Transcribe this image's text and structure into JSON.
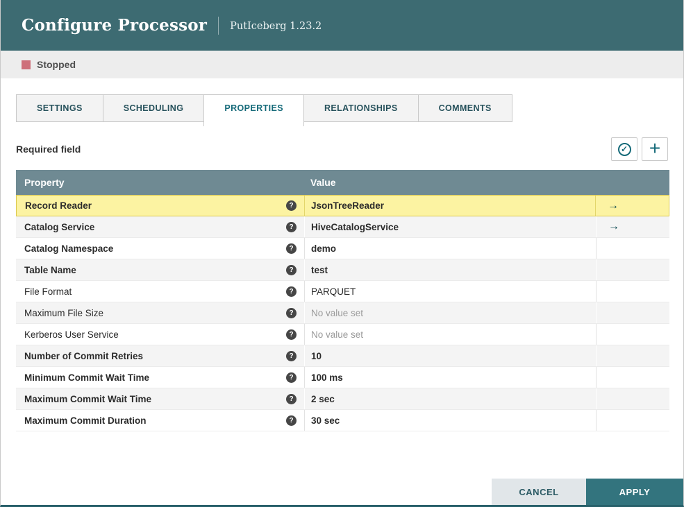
{
  "header": {
    "title": "Configure Processor",
    "subtitle": "PutIceberg 1.23.2"
  },
  "status": {
    "label": "Stopped"
  },
  "tabs": [
    {
      "label": "SETTINGS",
      "active": false
    },
    {
      "label": "SCHEDULING",
      "active": false
    },
    {
      "label": "PROPERTIES",
      "active": true
    },
    {
      "label": "RELATIONSHIPS",
      "active": false
    },
    {
      "label": "COMMENTS",
      "active": false
    }
  ],
  "properties_panel": {
    "required_label": "Required field"
  },
  "icons": {
    "help": "?",
    "goto_arrow": "→",
    "add_property": "+",
    "verify_check": "✓"
  },
  "table": {
    "columns": [
      "Property",
      "Value"
    ],
    "rows": [
      {
        "property": "Record Reader",
        "value": "JsonTreeReader",
        "required": true,
        "empty": false,
        "has_link": true,
        "selected": true
      },
      {
        "property": "Catalog Service",
        "value": "HiveCatalogService",
        "required": true,
        "empty": false,
        "has_link": true,
        "selected": false
      },
      {
        "property": "Catalog Namespace",
        "value": "demo",
        "required": true,
        "empty": false,
        "has_link": false,
        "selected": false
      },
      {
        "property": "Table Name",
        "value": "test",
        "required": true,
        "empty": false,
        "has_link": false,
        "selected": false
      },
      {
        "property": "File Format",
        "value": "PARQUET",
        "required": false,
        "empty": false,
        "has_link": false,
        "selected": false
      },
      {
        "property": "Maximum File Size",
        "value": "No value set",
        "required": false,
        "empty": true,
        "has_link": false,
        "selected": false
      },
      {
        "property": "Kerberos User Service",
        "value": "No value set",
        "required": false,
        "empty": true,
        "has_link": false,
        "selected": false
      },
      {
        "property": "Number of Commit Retries",
        "value": "10",
        "required": true,
        "empty": false,
        "has_link": false,
        "selected": false
      },
      {
        "property": "Minimum Commit Wait Time",
        "value": "100 ms",
        "required": true,
        "empty": false,
        "has_link": false,
        "selected": false
      },
      {
        "property": "Maximum Commit Wait Time",
        "value": "2 sec",
        "required": true,
        "empty": false,
        "has_link": false,
        "selected": false
      },
      {
        "property": "Maximum Commit Duration",
        "value": "30 sec",
        "required": true,
        "empty": false,
        "has_link": false,
        "selected": false
      }
    ]
  },
  "footer": {
    "cancel_label": "CANCEL",
    "apply_label": "APPLY"
  },
  "colors": {
    "header_bg": "#3d6b72",
    "table_header_bg": "#6f8a93",
    "selected_row_bg": "#fcf3a2",
    "selected_row_border": "#dcc94e",
    "accent": "#156a79",
    "stopped_red": "#ce6f7a",
    "apply_bg": "#33747e"
  }
}
